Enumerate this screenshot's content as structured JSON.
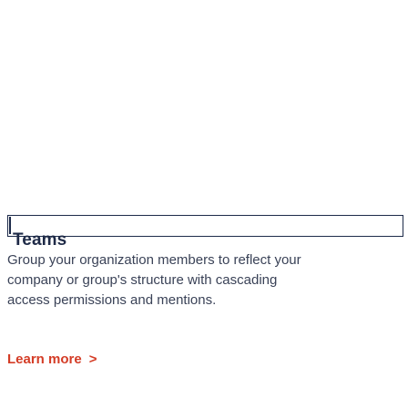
{
  "section": {
    "title": "Teams",
    "description": "Group your organization members to reflect your company or group's structure with cascading access permissions and mentions.",
    "learn_more_label": "Learn more",
    "learn_more_chevron": ">"
  },
  "colors": {
    "heading": "#1e2a47",
    "body_text": "#3a4257",
    "link": "#d43c26",
    "border": "#1d2b4a"
  }
}
